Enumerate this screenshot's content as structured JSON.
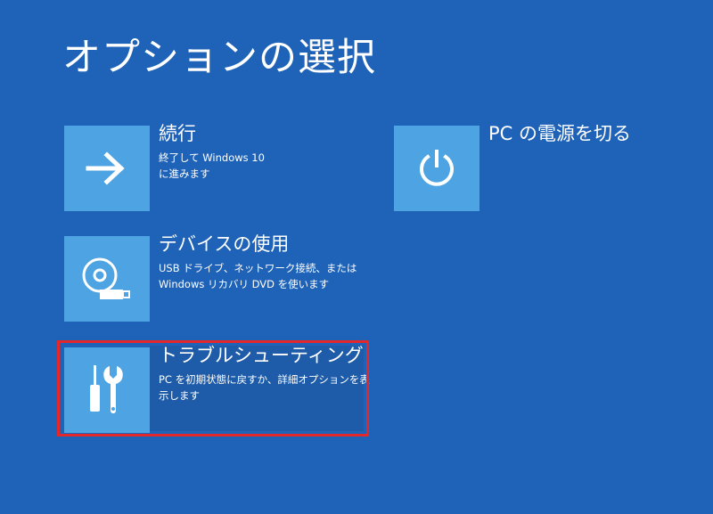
{
  "page_title": "オプションの選択",
  "options": [
    {
      "title": "続行",
      "description_line1": "終了して Windows 10",
      "description_line2": "に進みます",
      "icon": "arrow-right-icon"
    },
    {
      "title": "デバイスの使用",
      "description_line1": "USB ドライブ、ネットワーク接続、または",
      "description_line2": "Windows リカバリ DVD を使います",
      "icon": "disc-usb-icon"
    },
    {
      "title": "トラブルシューティング",
      "description_line1": "PC を初期状態に戻すか、詳細オプションを表",
      "description_line2": "示します",
      "icon": "tools-icon"
    },
    {
      "title": "PC の電源を切る",
      "icon": "power-icon"
    }
  ],
  "colors": {
    "background": "#1f63b8",
    "tile": "#4ea3e2",
    "highlight_border": "#e3272b"
  }
}
